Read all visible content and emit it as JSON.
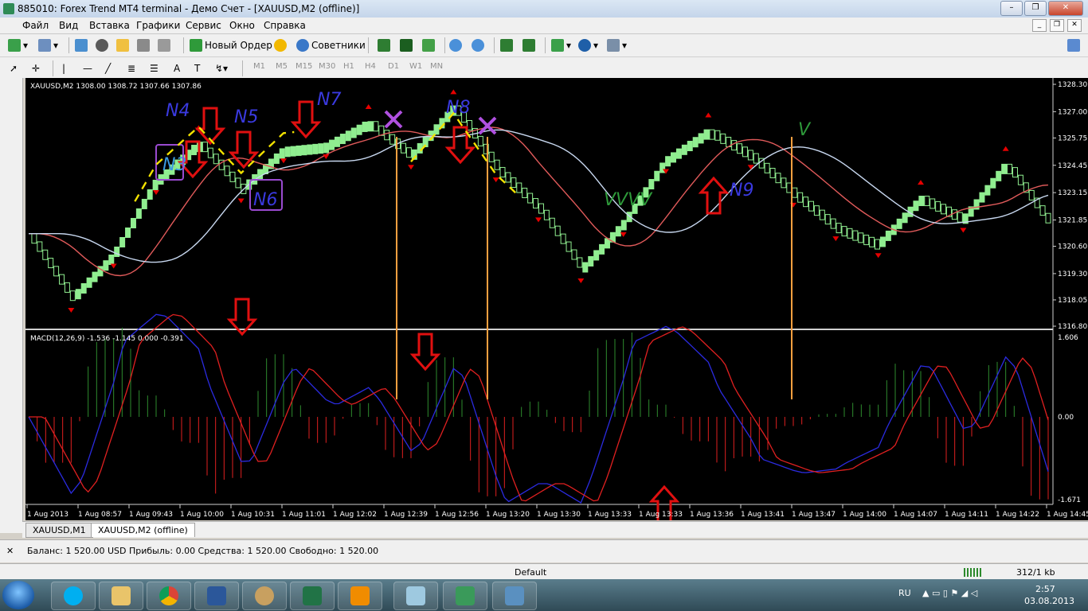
{
  "window": {
    "title": "885010: Forex Trend MT4 terminal - Демо Счет - [XAUUSD,M2 (offline)]"
  },
  "menu": [
    "Файл",
    "Вид",
    "Вставка",
    "Графики",
    "Сервис",
    "Окно",
    "Справка"
  ],
  "toolbar": {
    "new_order": "Новый Ордер",
    "experts": "Советники"
  },
  "timeframes": [
    "M1",
    "M5",
    "M15",
    "M30",
    "H1",
    "H4",
    "D1",
    "W1",
    "MN"
  ],
  "chart": {
    "symbol_header": "XAUUSD,M2  1308.00 1308.72 1307.66 1307.86",
    "macd_header": "MACD(12,26,9) -1.536 -1.145 0.000 -0.391",
    "price_ticks": [
      "1328.30",
      "1327.00",
      "1325.75",
      "1324.45",
      "1323.15",
      "1321.85",
      "1320.60",
      "1319.30",
      "1318.05",
      "1316.80"
    ],
    "macd_ticks": [
      "1.606",
      "0.00",
      "-1.671"
    ],
    "time_ticks": [
      "1 Aug 2013",
      "1 Aug 08:57",
      "1 Aug 09:43",
      "1 Aug 10:00",
      "1 Aug 10:31",
      "1 Aug 11:01",
      "1 Aug 12:02",
      "1 Aug 12:39",
      "1 Aug 12:56",
      "1 Aug 13:20",
      "1 Aug 13:30",
      "1 Aug 13:33",
      "1 Aug 13:33",
      "1 Aug 13:36",
      "1 Aug 13:41",
      "1 Aug 13:47",
      "1 Aug 14:00",
      "1 Aug 14:07",
      "1 Aug 14:11",
      "1 Aug 14:22",
      "1 Aug 14:45"
    ],
    "annotations": [
      "N4",
      "N5",
      "N7",
      "N8",
      "N3",
      "N6",
      "N9",
      "VVVV",
      "V"
    ],
    "colors": {
      "bull": "#90ee90",
      "bear": "#000000",
      "fast_ma": "#e05a5a",
      "slow_ma": "#c8d8f0",
      "macd": "#2b2be0",
      "signal": "#e02020",
      "hist_up": "#2e8b2e",
      "hist_down": "#e02020",
      "marker": "#e60000",
      "orange": "#ffa040"
    }
  },
  "chart_data": {
    "type": "line",
    "title": "XAUUSD,M2",
    "ylim": [
      1316.8,
      1328.3
    ],
    "series": [
      {
        "name": "XAUUSD,M2",
        "x": [
          0,
          4,
          8,
          12,
          16,
          20,
          24,
          28,
          32,
          36,
          40,
          44,
          48,
          52,
          56,
          60,
          64,
          68,
          72,
          76,
          80,
          84,
          88,
          92,
          96
        ],
        "values": [
          1321.2,
          1318.2,
          1320.3,
          1323.8,
          1325.6,
          1323.4,
          1325.3,
          1325.5,
          1326.6,
          1325.0,
          1327.3,
          1324.4,
          1322.5,
          1319.6,
          1321.8,
          1324.8,
          1326.2,
          1325.0,
          1323.2,
          1321.6,
          1320.8,
          1323.0,
          1322.0,
          1324.6,
          1321.8
        ]
      }
    ]
  },
  "tabs": [
    {
      "label": "XAUUSD,M1"
    },
    {
      "label": "XAUUSD,M2 (offline)"
    }
  ],
  "terminal": {
    "account_line": "Баланс: 1 520.00 USD  Прибыль: 0.00  Средства: 1 520.00  Свободно: 1 520.00"
  },
  "statusbar": {
    "profile": "Default",
    "traffic": "312/1 kb"
  },
  "tray": {
    "lang": "RU",
    "time": "2:57",
    "date": "03.08.2013"
  }
}
